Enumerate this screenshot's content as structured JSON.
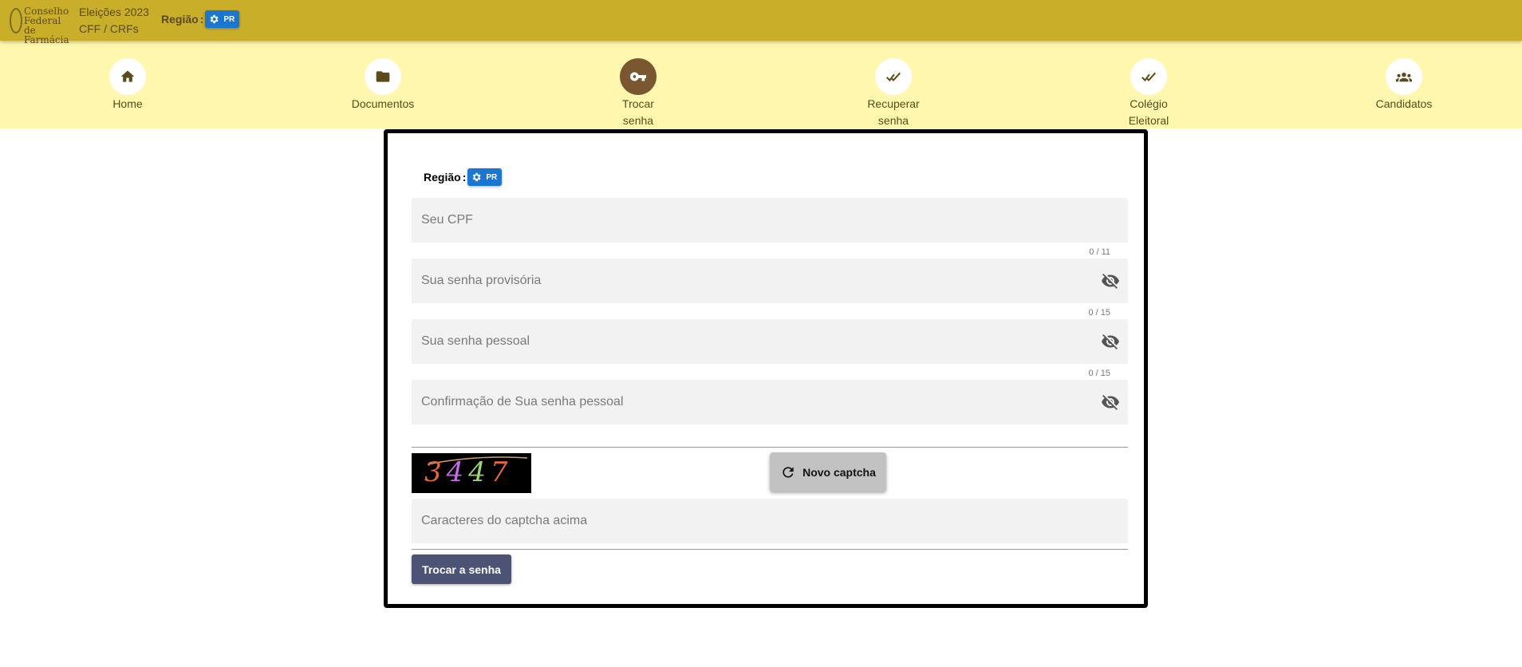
{
  "header": {
    "logo_lines": [
      "Conselho",
      "Federal de",
      "Farmácia"
    ],
    "brand_line1": "Eleições 2023",
    "brand_line2": "CFF / CRFs",
    "region_label": "Região",
    "region_value": "PR"
  },
  "nav": {
    "items": [
      {
        "label": "Home",
        "icon": "home-icon"
      },
      {
        "label": "Documentos",
        "icon": "folder-icon"
      },
      {
        "label": "Trocar senha",
        "icon": "key-icon",
        "active": true
      },
      {
        "label": "Recuperar senha",
        "icon": "double-check-icon"
      },
      {
        "label": "Colégio Eleitoral",
        "icon": "double-check-icon"
      },
      {
        "label": "Candidatos",
        "icon": "group-icon"
      }
    ]
  },
  "form": {
    "region_label": "Região",
    "region_value": "PR",
    "cpf_placeholder": "Seu CPF",
    "cpf_counter": "0 / 11",
    "temp_password_placeholder": "Sua senha provisória",
    "temp_password_counter": "0 / 15",
    "personal_password_placeholder": "Sua senha pessoal",
    "personal_password_counter": "0 / 15",
    "confirm_password_placeholder": "Confirmação de Sua senha pessoal",
    "captcha_text": "3447",
    "new_captcha_label": "Novo captcha",
    "captcha_placeholder": "Caracteres do captcha acima",
    "submit_label": "Trocar a senha"
  },
  "colors": {
    "topbar": "#c9ae2a",
    "navbar": "#fff7ad",
    "active_nav": "#7a5730",
    "region_chip": "#1976d2",
    "submit_button": "#4d5375"
  }
}
